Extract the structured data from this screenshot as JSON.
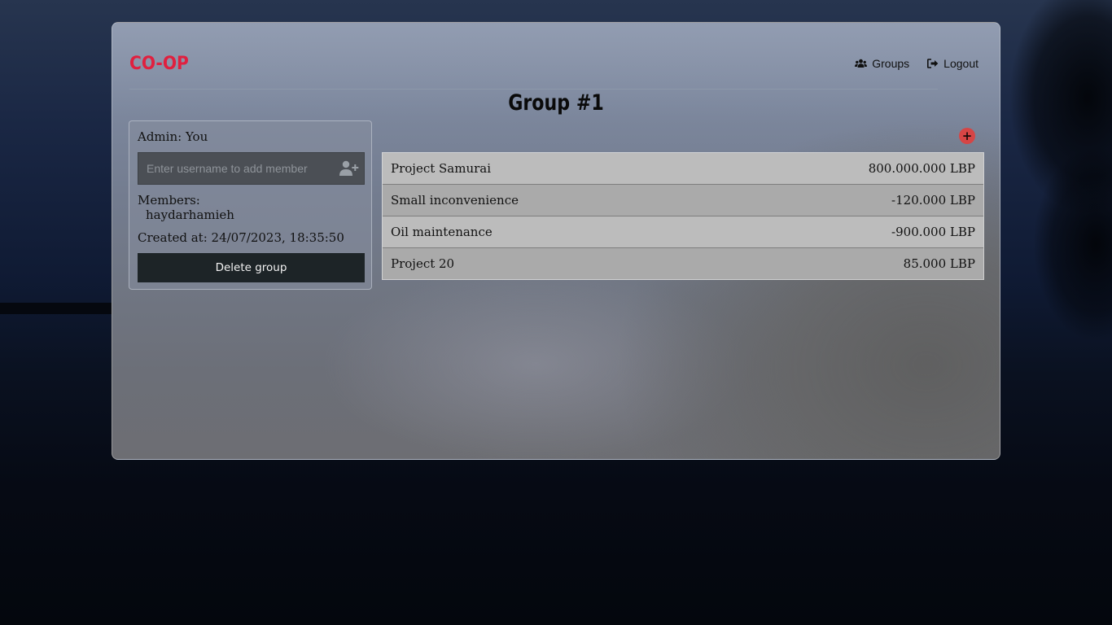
{
  "app": {
    "logo": "CO-OP"
  },
  "nav": {
    "groups_label": "Groups",
    "logout_label": "Logout"
  },
  "page": {
    "title": "Group #1"
  },
  "group_info": {
    "admin_text": "Admin: You",
    "add_member_placeholder": "Enter username to add member",
    "add_member_value": "",
    "members_label": "Members:",
    "members": [
      "haydarhamieh"
    ],
    "created_at_text": "Created at: 24/07/2023, 18:35:50",
    "delete_label": "Delete group"
  },
  "entries": {
    "add_label": "+",
    "rows": [
      {
        "name": "Project Samurai",
        "amount": "800.000.000 LBP"
      },
      {
        "name": "Small inconvenience",
        "amount": "-120.000 LBP"
      },
      {
        "name": "Oil maintenance",
        "amount": "-900.000 LBP"
      },
      {
        "name": "Project 20",
        "amount": "85.000 LBP"
      }
    ]
  },
  "colors": {
    "brand": "#e0203f",
    "delete_button": "#1d2427",
    "add_button": "#d64545"
  },
  "icons": {
    "groups": "users-icon",
    "logout": "sign-out-icon",
    "add_member": "user-plus-icon"
  }
}
